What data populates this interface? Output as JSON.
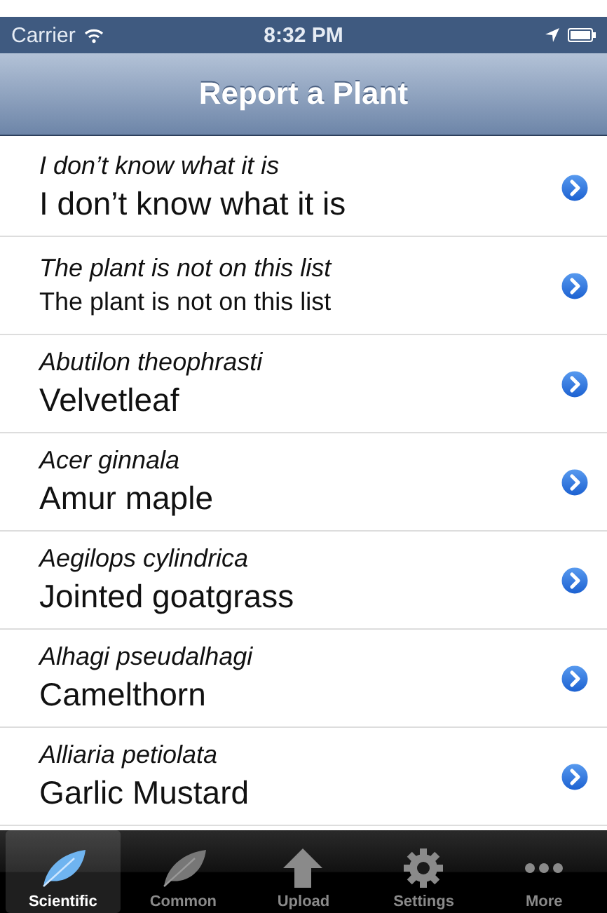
{
  "status_bar": {
    "carrier": "Carrier",
    "time": "8:32 PM"
  },
  "nav_bar": {
    "title": "Report a Plant"
  },
  "rows": [
    {
      "scientific": "I don’t know what it is",
      "common": "I don’t know what it is",
      "kind": "standard"
    },
    {
      "scientific": "The plant is not on this list",
      "common": "The plant is not on this list",
      "kind": "compact"
    },
    {
      "scientific": "Abutilon theophrasti",
      "common": "Velvetleaf",
      "kind": "standard"
    },
    {
      "scientific": "Acer ginnala",
      "common": "Amur maple",
      "kind": "standard"
    },
    {
      "scientific": "Aegilops cylindrica",
      "common": "Jointed goatgrass",
      "kind": "standard"
    },
    {
      "scientific": "Alhagi pseudalhagi",
      "common": "Camelthorn",
      "kind": "standard"
    },
    {
      "scientific": "Alliaria petiolata",
      "common": "Garlic Mustard",
      "kind": "standard"
    }
  ],
  "tabs": [
    {
      "label": "Scientific",
      "kind": "leaf",
      "selected": true
    },
    {
      "label": "Common",
      "kind": "leaf",
      "selected": false
    },
    {
      "label": "Upload",
      "kind": "upload",
      "selected": false
    },
    {
      "label": "Settings",
      "kind": "gear",
      "selected": false
    },
    {
      "label": "More",
      "kind": "more",
      "selected": false
    }
  ]
}
